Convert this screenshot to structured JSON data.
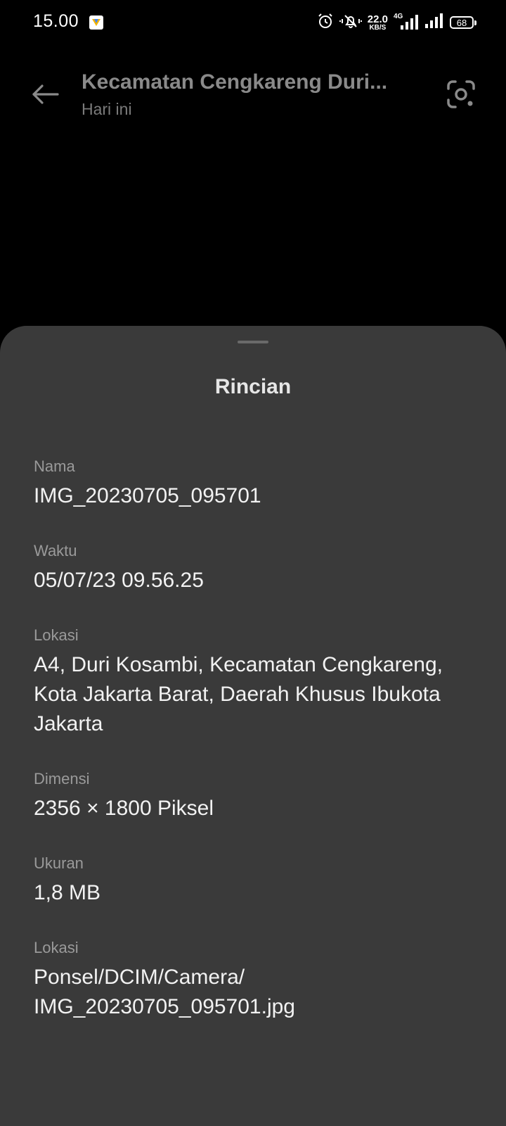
{
  "status_bar": {
    "time": "15.00",
    "net_speed_value": "22.0",
    "net_speed_unit": "KB/S",
    "network_type": "4G",
    "battery": "68"
  },
  "app_bar": {
    "title": "Kecamatan Cengkareng Duri...",
    "subtitle": "Hari ini",
    "back_icon": "arrow-left-icon",
    "lens_icon": "lens-scan-icon"
  },
  "sheet": {
    "title": "Rincian",
    "details": [
      {
        "label": "Nama",
        "value": "IMG_20230705_095701"
      },
      {
        "label": "Waktu",
        "value": "05/07/23 09.56.25"
      },
      {
        "label": "Lokasi",
        "value": "A4, Duri Kosambi, Kecamatan Cengkareng, Kota Jakarta Barat, Daerah Khusus Ibukota Jakarta"
      },
      {
        "label": "Dimensi",
        "value": "2356 × 1800 Piksel"
      },
      {
        "label": "Ukuran",
        "value": "1,8 MB"
      },
      {
        "label": "Lokasi",
        "value": "Ponsel/DCIM/Camera/\nIMG_20230705_095701.jpg"
      }
    ]
  },
  "colors": {
    "background": "#000000",
    "sheet": "#3a3a3a",
    "label": "#9a9a9a",
    "value": "#f2f2f2"
  }
}
